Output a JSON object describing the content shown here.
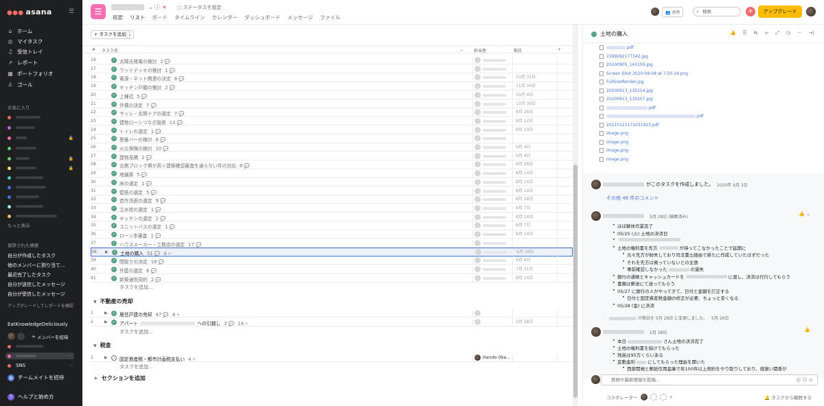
{
  "sidebar": {
    "logo": "asana",
    "nav": [
      "ホーム",
      "マイタスク",
      "受信トレイ",
      "レポート",
      "ポートフォリオ",
      "ゴール"
    ],
    "favorites_header": "お気に入り",
    "show_more": "もっと表示",
    "saved_header": "保存された検索",
    "saved": [
      "自分が作成したタスク",
      "他のメンバーに割り当て...",
      "最近完了したタスク",
      "自分が送信したメッセージ",
      "自分が受信したメッセージ"
    ],
    "upgrade_hint": "アップグレードしてレポートを確認",
    "team": "EatKnowledgeDeliciously",
    "invite_member": "メンバーを招待",
    "sns": "SNS",
    "invite_teammates": "チームメイトを招待",
    "help": "ヘルプと始め方"
  },
  "topbar": {
    "status": "ステータスを設定",
    "tabs": [
      "概要",
      "リスト",
      "ボード",
      "タイムライン",
      "カレンダー",
      "ダッシュボード",
      "メッセージ",
      "ファイル"
    ],
    "share": "共有",
    "search_placeholder": "検索",
    "upgrade": "アップグレード"
  },
  "list": {
    "add_task": "タスクを追加",
    "col_num": "#",
    "col_task": "タスク名",
    "col_assignee": "担当者",
    "col_due": "期日",
    "rows": [
      {
        "n": "16",
        "name": "太陽光発電の検討",
        "c": "2",
        "due": ""
      },
      {
        "n": "17",
        "name": "ウッドデッキの検討",
        "c": "1",
        "due": ""
      },
      {
        "n": "18",
        "name": "電源・ネット関連の決定",
        "c": "8",
        "due": "10月 31日"
      },
      {
        "n": "19",
        "name": "キッチン戸棚の検討",
        "c": "2",
        "due": "11月 30日"
      },
      {
        "n": "20",
        "name": "上棟式",
        "c": "5",
        "due": "10月 4日"
      },
      {
        "n": "21",
        "name": "外構の決定",
        "c": "7",
        "due": "10月 30日"
      },
      {
        "n": "22",
        "name": "サッシ・玄関ドアの選定",
        "c": "7",
        "due": "8月 28日"
      },
      {
        "n": "23",
        "name": "建物ローンつなぎ融資",
        "c": "13",
        "due": "8月 22日"
      },
      {
        "n": "24",
        "name": "トイレの選定",
        "c": "1",
        "due": "8月 23日"
      },
      {
        "n": "25",
        "name": "懸垂バーの検討",
        "c": "6",
        "due": ""
      },
      {
        "n": "26",
        "name": "火災保険の検討",
        "c": "10",
        "due": "9月 4日"
      },
      {
        "n": "27",
        "name": "建物見積",
        "c": "2",
        "due": "9月 4日"
      },
      {
        "n": "28",
        "name": "北側ブロック塀が高く建築確認審査を通らない件の対応",
        "c": "8",
        "due": "8月 28日"
      },
      {
        "n": "29",
        "name": "地鎮祭",
        "c": "5",
        "due": "8月 14日"
      },
      {
        "n": "30",
        "name": "床の選定",
        "c": "1",
        "due": "8月 14日"
      },
      {
        "n": "31",
        "name": "壁紙の選定",
        "c": "5",
        "due": "8月 14日"
      },
      {
        "n": "32",
        "name": "造作洗面の選定",
        "c": "9",
        "due": "8月 28日"
      },
      {
        "n": "33",
        "name": "立水栓の選定",
        "c": "1",
        "due": "8月 7日"
      },
      {
        "n": "34",
        "name": "キッチンの選定",
        "c": "2",
        "due": "8月 14日"
      },
      {
        "n": "35",
        "name": "ユニットバスの選定",
        "c": "1",
        "due": "8月 7日"
      },
      {
        "n": "36",
        "name": "ローン本審査",
        "c": "1",
        "due": "8月 14日"
      },
      {
        "n": "37",
        "name": "ハウスメーカー・工務店の選定",
        "c": "17",
        "due": ""
      },
      {
        "n": "38",
        "name": "土地の購入",
        "c": "51",
        "sub": "4",
        "due": "5月 28日"
      },
      {
        "n": "39",
        "name": "間取りの決定",
        "c": "18",
        "due": "6月 6日"
      },
      {
        "n": "40",
        "name": "外壁の選定",
        "c": "6",
        "due": "7月 31日"
      },
      {
        "n": "41",
        "name": "新築通色契約",
        "c": "2",
        "due": "8月 14日"
      }
    ],
    "add_task_row": "タスクを追加...",
    "section2": "不動産の売却",
    "s2_rows": [
      {
        "n": "1",
        "name": "居住戸建の売却",
        "c": "47",
        "sub": "4",
        "due": ""
      },
      {
        "n": "2",
        "name": "アパート",
        "tail": "への引越し",
        "c": "3",
        "sub": "14",
        "due": "2月 28日"
      }
    ],
    "section3": "税金",
    "s3_rows": [
      {
        "n": "1",
        "name": "固定資産税・都市計画税支払い",
        "sub": "4",
        "assignee": "Haruto Oka...",
        "due": ""
      }
    ],
    "add_section": "セクションを追加"
  },
  "detail": {
    "title": "土地の購入",
    "attachments": [
      ".pdf",
      "1599282177342.jpg",
      "20200905_143159.jpg",
      "Screen Shot 2020-09-08 at 7.50.34.png",
      "FullSizeRender.jpg",
      "20200913_135214.jpg",
      "20200913_135207.jpg",
      ".pdf",
      ".pdf",
      "20210121171031923.pdf",
      "image.png",
      "image.png",
      "image.png",
      "image.png"
    ],
    "created": "がこのタスクを作成しました。",
    "created_date": "2020年 9月 3日",
    "more_comments": "その他 48 件のコメント",
    "comment_date": "5月 28日 (編集済み)",
    "bullets": [
      "ほぼ解体作業完了",
      "05/25 (火) 土地の決済日",
      "土地の権利書を先方",
      "が持ってこなかったことで延期に",
      "元々先方が紛失しており司法書士経由で新たに作成していたはずだった",
      "それを先方は買っていないとの主張",
      "事前確認しなかった",
      "の過失",
      "銀行の通帳とキャッシュカードを",
      "に渡し、決済は代行してもらう",
      "書類は郵送にて送ってもらう",
      "05/27 に銀行の人がやってきて、日付と金額を訂正する",
      "日付と固定資産税金額の修正が必要、ちょっと安くなる",
      "05/28 (金) に決済"
    ],
    "changed_due": "が期日を 5月 28日 に変更しました。",
    "changed_date": "5月 26日",
    "comment2_date": "5月 28日",
    "bullets2": [
      "本日",
      "さん土地の決済完了",
      "土地の権利書を揃けてもらった",
      "残高は95万くらいある",
      "変動金利",
      "にしてもらった理由を聞いた",
      "西部開発と郵総信用金庫で年100件以上契約をやり取りしており、感謝い関係が"
    ],
    "comment_placeholder": "質問や最新情報を投稿...",
    "collaborators": "コラボレーター",
    "leave": "タスクから離脱する"
  }
}
